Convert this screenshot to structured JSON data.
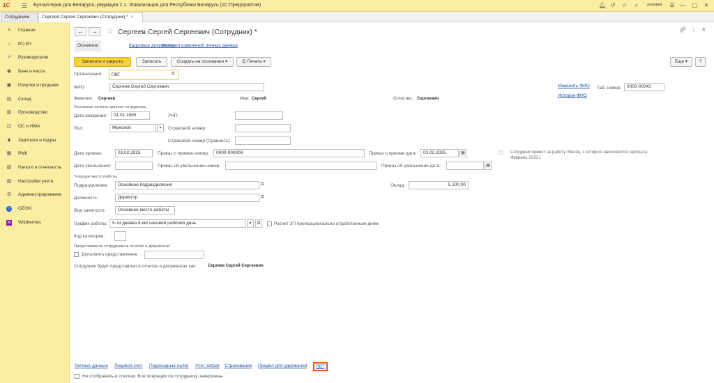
{
  "titlebar": {
    "logo": "1С",
    "title": "Бухгалтерия для Беларуси, редакция 2.1. Локализация для Республики Беларусь  (1С:Предприятие)",
    "user": "assistant"
  },
  "tabs": [
    {
      "label": "Сотрудники"
    },
    {
      "label": "Сергеев Сергей Сергеевич (Сотрудник) *"
    }
  ],
  "sidebar": {
    "items": [
      {
        "label": "Главное",
        "icon": "≡"
      },
      {
        "label": "РО.BY",
        "icon": "⌂"
      },
      {
        "label": "Руководителю",
        "icon": "↗"
      },
      {
        "label": "Банк и касса",
        "icon": "◉"
      },
      {
        "label": "Покупки и продажи",
        "icon": "▣"
      },
      {
        "label": "Склад",
        "icon": "▤"
      },
      {
        "label": "Производство",
        "icon": "▥"
      },
      {
        "label": "ОС и НМА",
        "icon": "◫"
      },
      {
        "label": "Зарплата и кадры",
        "icon": "♟"
      },
      {
        "label": "РМК",
        "icon": "▦"
      },
      {
        "label": "Налоги и отчетность",
        "icon": "▧"
      },
      {
        "label": "Настройки учета",
        "icon": "▨"
      },
      {
        "label": "Администрирование",
        "icon": "⚙"
      },
      {
        "label": "OZON",
        "icon": "O"
      },
      {
        "label": "Wildberries",
        "icon": "W"
      }
    ]
  },
  "form": {
    "title": "Сергеев Сергей Сергеевич (Сотрудник) *",
    "subtabs": {
      "main": "Основное",
      "hr_docs": "Кадровые документы",
      "history": "История изменений личных данных"
    },
    "toolbar": {
      "save_close": "Записать и закрыть",
      "save": "Записать",
      "create_base": "Создать на основании",
      "print": "Печать",
      "more": "Еще",
      "help": "?"
    },
    "org_label": "Организация:",
    "org_value": "ПВТ",
    "fio_label": "ФИО:",
    "fio_value": "Сергеев Сергей Сергеевич",
    "change_fio": "Изменить ФИО",
    "tab_num_label": "Таб. номер:",
    "tab_num_value": "0000-00043",
    "fio_history": "История ФИО",
    "surname_label": "Фамилия:",
    "surname_value": "Сергеев",
    "name_label": "Имя:",
    "name_value": "Сергей",
    "patronymic_label": "Отчество:",
    "patronymic_value": "Сергеевич",
    "personal_section": "Основные личные данные сотрудника",
    "birth_label": "Дата рождения:",
    "birth_value": "01.01.1985",
    "unp_label": "УНП:",
    "gender_label": "Пол:",
    "gender_value": "Мужской",
    "insurance_label": "Страховой номер:",
    "insurance_compare_label": "Страховой номер (Сравнить):",
    "hire_date_label": "Дата приема:",
    "hire_date_value": "03.02.2025",
    "hire_order_label": "Приказ о приеме номер:",
    "hire_order_value": "0000-000008",
    "hire_order_date_label": "Приказ о приеме дата:",
    "hire_order_date_value": "03.02.2025",
    "hire_note": "Сотрудник принят на работу. Месяц, с которого начисляется зарплата: Февраль 2025 г.",
    "fire_date_label": "Дата увольнения:",
    "fire_date_placeholder": " .  .",
    "fire_order_label": "Приказ об увольнении номер:",
    "fire_order_date_label": "Приказ об увольнении дата:",
    "fire_order_date_placeholder": " .  .",
    "workplace_section": "Текущее место работы",
    "dept_label": "Подразделение:",
    "dept_value": "Основное подразделение",
    "salary_label": "Оклад:",
    "salary_value": "5 100,00",
    "position_label": "Должность:",
    "position_value": "Директор",
    "employment_label": "Вид занятости:",
    "employment_value": "Основное место работы",
    "schedule_label": "График работы:",
    "schedule_value": "5-ти дневка 8-ми часовой рабочий день",
    "proportional_label": "Расчет ЗП пропорционально отработанным дням",
    "category_label": "Код категории:",
    "representation_section": "Представление сотрудника в отчетах и документах",
    "supplement_label": "Дополнять представление",
    "represented_label": "Сотрудник будет представлен в отчетах и документах как:",
    "represented_value": "Сергеев Сергей Сергеевич",
    "bottom_links": {
      "personal": "Личные данные",
      "account": "Лицевой счет",
      "income_tax": "Подоходный налог",
      "cost": "Учет затрат",
      "insurance": "Страхование",
      "deduction_limit": "Предел для удержаний",
      "pvt": "ПВТ"
    },
    "hide_label": "Не отображать в списках. Все операции по сотруднику завершены"
  },
  "colors": {
    "accent_yellow": "#fbeda2",
    "primary_button": "#f7d33a",
    "link": "#2554a7",
    "highlight": "#e05a1a"
  }
}
